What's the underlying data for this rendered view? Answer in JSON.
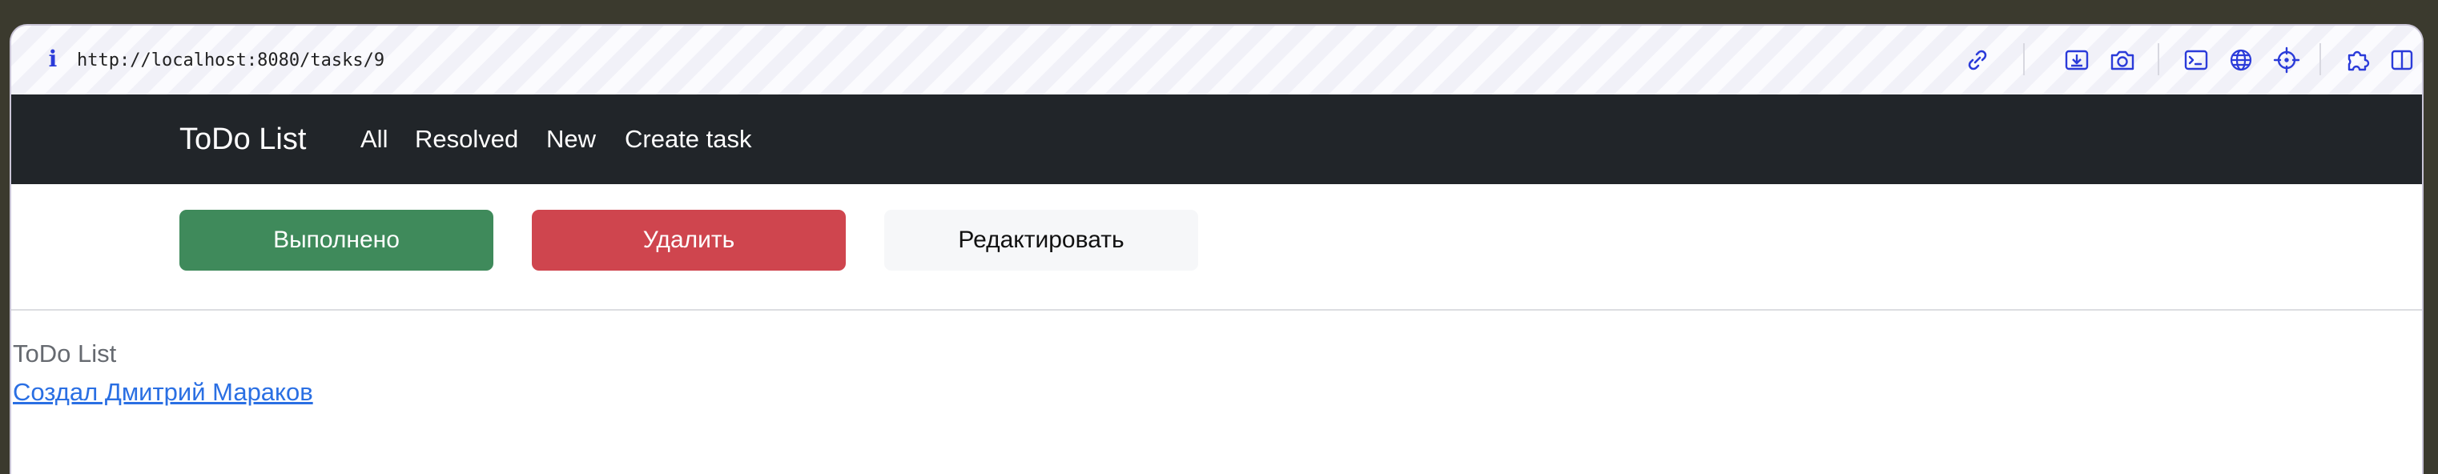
{
  "browser": {
    "url": "http://localhost:8080/tasks/9",
    "toolbar_icons": [
      "link-icon",
      "download-icon",
      "camera-icon",
      "terminal-icon",
      "globe-icon",
      "crosshair-icon",
      "extensions-icon",
      "sidebar-icon"
    ]
  },
  "navbar": {
    "brand": "ToDo List",
    "links": [
      "All",
      "Resolved",
      "New",
      "Create task"
    ]
  },
  "actions": {
    "complete_label": "Выполнено",
    "delete_label": "Удалить",
    "edit_label": "Редактировать"
  },
  "footer": {
    "title": "ToDo List",
    "author_link": "Создал Дмитрий Мараков"
  },
  "colors": {
    "navbar_bg": "#212529",
    "success": "#3f8a5b",
    "danger": "#cf454e",
    "light": "#f6f7f9",
    "link": "#2a6fe3"
  }
}
